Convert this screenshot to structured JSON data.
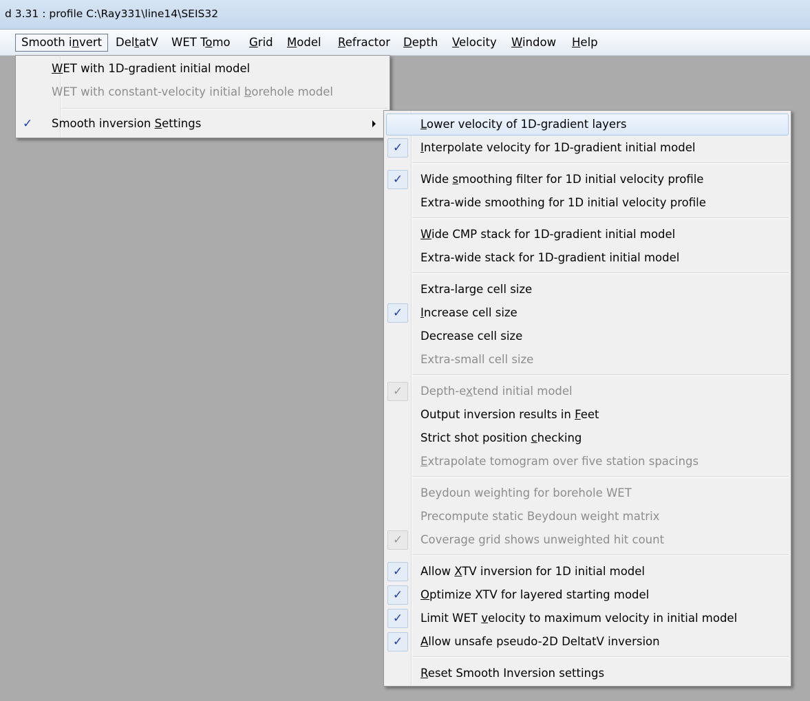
{
  "window": {
    "title": "d 3.31 : profile C:\\Ray331\\line14\\SEIS32"
  },
  "menubar": [
    {
      "pre": "Smooth i",
      "acc": "n",
      "post": "vert"
    },
    {
      "pre": "Del",
      "acc": "t",
      "post": "atV"
    },
    {
      "pre": "WET T",
      "acc": "o",
      "post": "mo"
    },
    {
      "pre": "",
      "acc": "G",
      "post": "rid"
    },
    {
      "pre": "",
      "acc": "M",
      "post": "odel"
    },
    {
      "pre": "",
      "acc": "R",
      "post": "efractor"
    },
    {
      "pre": "",
      "acc": "D",
      "post": "epth"
    },
    {
      "pre": "",
      "acc": "V",
      "post": "elocity"
    },
    {
      "pre": "",
      "acc": "W",
      "post": "indow"
    },
    {
      "pre": "",
      "acc": "H",
      "post": "elp"
    }
  ],
  "smooth_menu": {
    "items": [
      {
        "pre": "",
        "acc": "W",
        "post": "ET with 1D-gradient initial model",
        "checked": false,
        "disabled": false
      },
      {
        "pre": "WET with constant-velocity initial ",
        "acc": "b",
        "post": "orehole model",
        "checked": false,
        "disabled": true
      },
      {
        "pre": "Smooth inversion ",
        "acc": "S",
        "post": "ettings",
        "checked": true,
        "disabled": false,
        "submenu": true,
        "check_glyph": "✓"
      }
    ]
  },
  "settings_submenu": {
    "check_glyph": "✓",
    "groups": [
      [
        {
          "pre": "",
          "acc": "L",
          "post": "ower velocity of 1D-gradient layers",
          "checked": false,
          "disabled": false,
          "highlighted": true
        },
        {
          "pre": "",
          "acc": "I",
          "post": "nterpolate velocity for 1D-gradient initial model",
          "checked": true,
          "disabled": false
        }
      ],
      [
        {
          "pre": "Wide ",
          "acc": "s",
          "post": "moothing filter for 1D initial velocity profile",
          "checked": true,
          "disabled": false
        },
        {
          "pre": "Extra-wide smoothing for 1D initial velocity profile",
          "acc": "",
          "post": "",
          "checked": false,
          "disabled": false
        }
      ],
      [
        {
          "pre": "",
          "acc": "W",
          "post": "ide CMP stack for 1D-gradient initial model",
          "checked": false,
          "disabled": false
        },
        {
          "pre": "Extra-wide stack for 1D-gradient initial model",
          "acc": "",
          "post": "",
          "checked": false,
          "disabled": false
        }
      ],
      [
        {
          "pre": "Extra-large cell size",
          "acc": "",
          "post": "",
          "checked": false,
          "disabled": false
        },
        {
          "pre": "",
          "acc": "I",
          "post": "ncrease cell size",
          "checked": true,
          "disabled": false
        },
        {
          "pre": "Decrease cell size",
          "acc": "",
          "post": "",
          "checked": false,
          "disabled": false
        },
        {
          "pre": "Extra-small cell size",
          "acc": "",
          "post": "",
          "checked": false,
          "disabled": true
        }
      ],
      [
        {
          "pre": "Depth-e",
          "acc": "x",
          "post": "tend initial model",
          "checked": true,
          "disabled": true
        },
        {
          "pre": "Output inversion results in ",
          "acc": "F",
          "post": "eet",
          "checked": false,
          "disabled": false
        },
        {
          "pre": "Strict shot position ",
          "acc": "c",
          "post": "hecking",
          "checked": false,
          "disabled": false
        },
        {
          "pre": "",
          "acc": "E",
          "post": "xtrapolate tomogram over five station spacings",
          "checked": false,
          "disabled": true
        }
      ],
      [
        {
          "pre": "Beydoun weighting for borehole WET",
          "acc": "",
          "post": "",
          "checked": false,
          "disabled": true
        },
        {
          "pre": "Precompute static Beydoun weight matrix",
          "acc": "",
          "post": "",
          "checked": false,
          "disabled": true
        },
        {
          "pre": "Coverage grid shows unweighted hit count",
          "acc": "",
          "post": "",
          "checked": true,
          "disabled": true
        }
      ],
      [
        {
          "pre": "Allow ",
          "acc": "X",
          "post": "TV inversion for 1D initial model",
          "checked": true,
          "disabled": false
        },
        {
          "pre": "",
          "acc": "O",
          "post": "ptimize XTV for layered starting model",
          "checked": true,
          "disabled": false
        },
        {
          "pre": "Limit WET ",
          "acc": "v",
          "post": "elocity to maximum velocity in initial model",
          "checked": true,
          "disabled": false
        },
        {
          "pre": "",
          "acc": "A",
          "post": "llow unsafe pseudo-2D DeltatV inversion",
          "checked": true,
          "disabled": false
        }
      ],
      [
        {
          "pre": "",
          "acc": "R",
          "post": "eset Smooth Inversion settings",
          "checked": false,
          "disabled": false
        }
      ]
    ]
  }
}
